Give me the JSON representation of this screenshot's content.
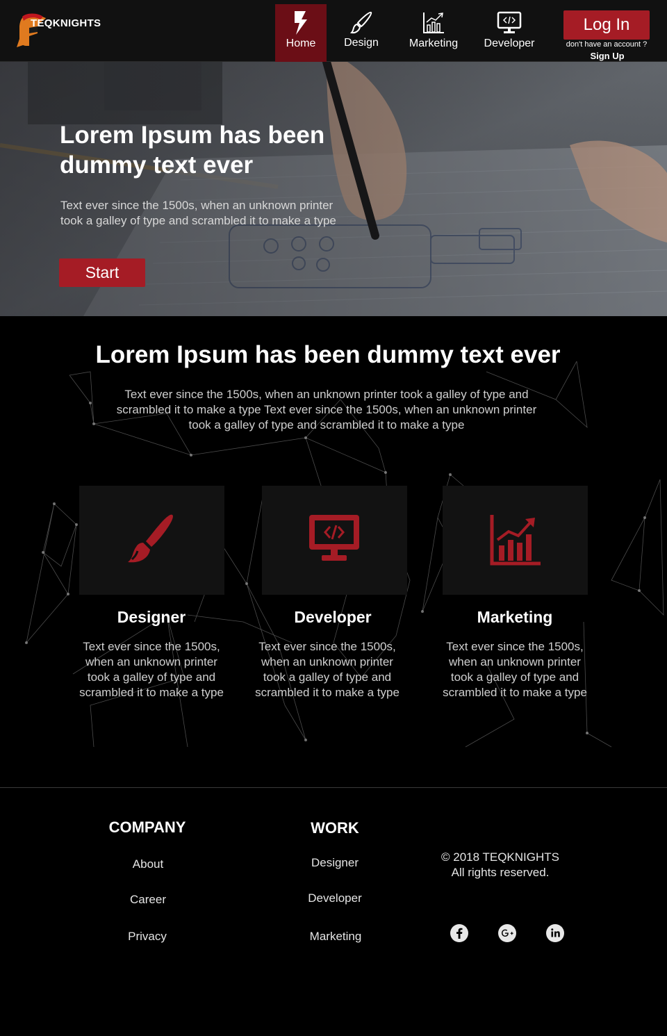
{
  "brand": {
    "name": "TEQKNIGHTS",
    "accent": "#a51c25",
    "dark_accent": "#6b0e16"
  },
  "nav": {
    "items": [
      {
        "label": "Home",
        "icon": "bolt-icon",
        "active": true
      },
      {
        "label": "Design",
        "icon": "paintbrush-icon"
      },
      {
        "label": "Marketing",
        "icon": "chart-icon"
      },
      {
        "label": "Developer",
        "icon": "monitor-code-icon"
      }
    ],
    "login_label": "Log In",
    "no_account_text": "don't have an account ?",
    "signup_label": "Sign Up"
  },
  "hero": {
    "title": "Lorem Ipsum has been dummy text ever",
    "text": "Text ever since the 1500s, when an unknown printer took a galley of type and scrambled it to make a type",
    "button_label": "Start"
  },
  "services": {
    "title": "Lorem Ipsum has been dummy text ever",
    "text": "Text ever since the 1500s, when an unknown printer took a galley of type and scrambled it to make a type Text ever since the 1500s, when an unknown printer took a galley of type and scrambled it to make a type",
    "cards": [
      {
        "title": "Designer",
        "icon": "paintbrush-icon",
        "text": "Text ever since the 1500s, when an unknown printer took a galley of type and scrambled it to make a type"
      },
      {
        "title": "Developer",
        "icon": "monitor-code-icon",
        "text": "Text ever since the 1500s, when an unknown printer took a galley of type and scrambled it to make a type"
      },
      {
        "title": "Marketing",
        "icon": "chart-icon",
        "text": "Text ever since the 1500s, when an unknown printer took a galley of type and scrambled it to make a type"
      }
    ]
  },
  "footer": {
    "company": {
      "heading": "COMPANY",
      "links": [
        "About",
        "Career",
        "Privacy"
      ]
    },
    "work": {
      "heading": "WORK",
      "links": [
        "Designer",
        "Developer",
        "Marketing"
      ]
    },
    "copyright_line1": "© 2018 TEQKNIGHTS",
    "copyright_line2": "All rights reserved.",
    "social": [
      "facebook-icon",
      "google-plus-icon",
      "linkedin-icon"
    ]
  }
}
